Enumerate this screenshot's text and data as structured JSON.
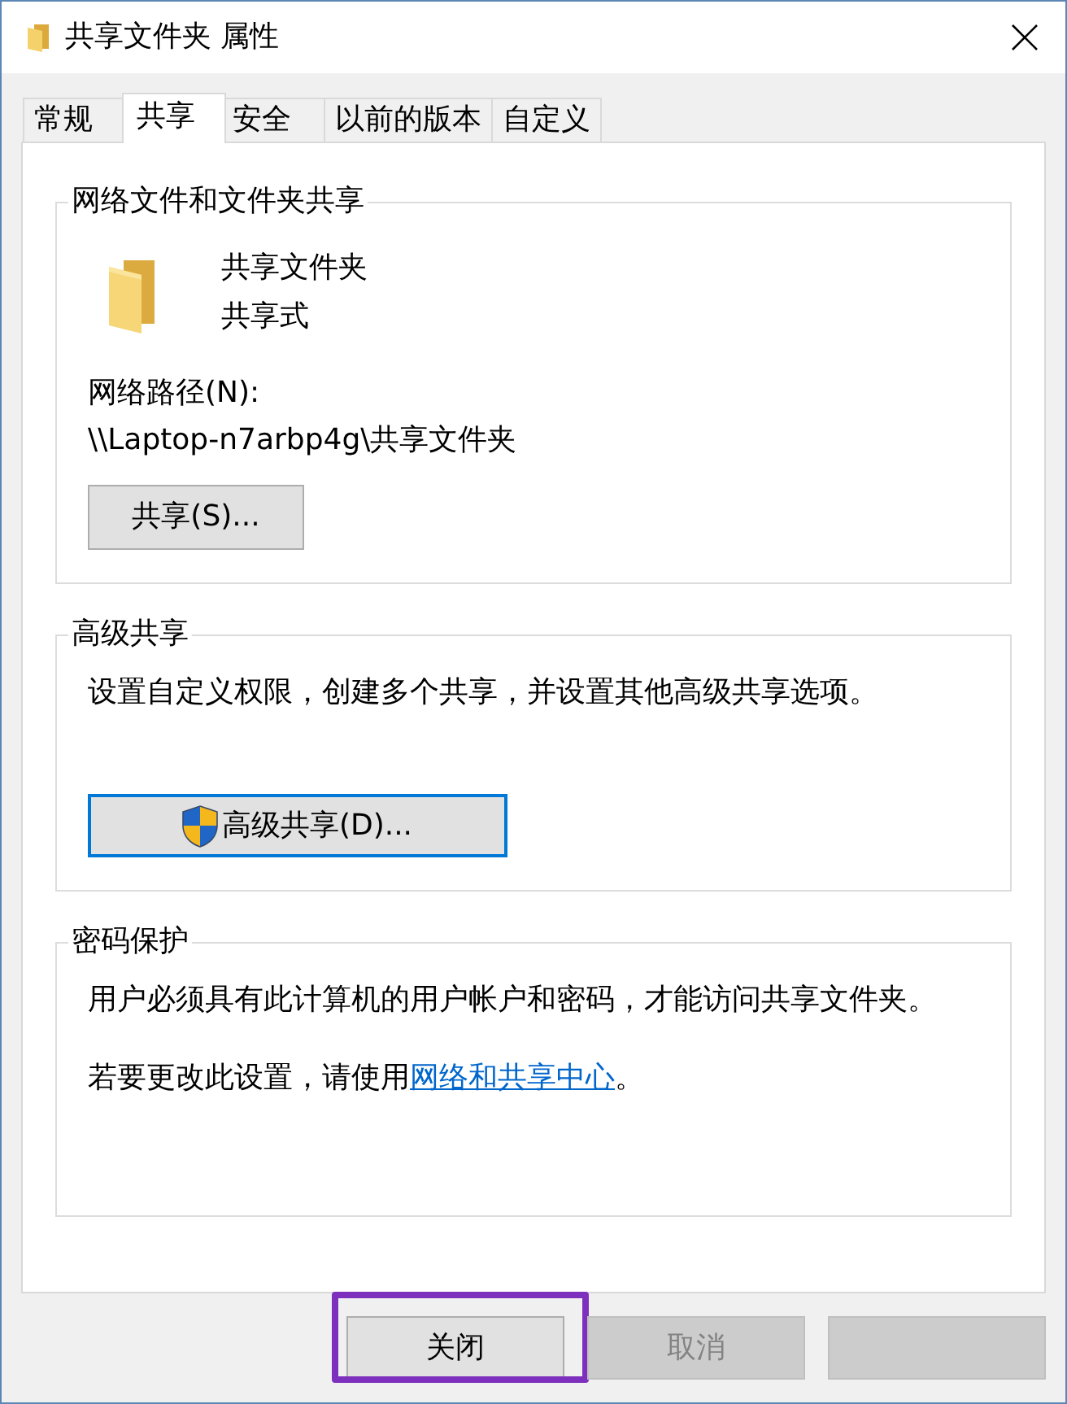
{
  "window": {
    "title": "共享文件夹 属性"
  },
  "tabs": [
    {
      "label": "常规",
      "selected": false
    },
    {
      "label": "共享",
      "selected": true
    },
    {
      "label": "安全",
      "selected": false
    },
    {
      "label": "以前的版本",
      "selected": false
    },
    {
      "label": "自定义",
      "selected": false
    }
  ],
  "groups": [
    {
      "title": "网络文件和文件夹共享",
      "items": [
        {
          "kind": "folder",
          "name": "共享文件夹",
          "status": "共享式"
        },
        {
          "kind": "label",
          "text": "网络路径(N):"
        },
        {
          "kind": "path",
          "text": "\\\\Laptop-n7arbp4g\\共享文件夹"
        },
        {
          "kind": "button",
          "label": "共享(S)...",
          "default": false,
          "shield": false
        }
      ]
    },
    {
      "title": "高级共享",
      "items": [
        {
          "kind": "text",
          "parts": [
            {
              "kind": "plain",
              "text": "设置自定义权限，创建多个共享，并设置其他高级共享选项。"
            }
          ]
        },
        {
          "kind": "button",
          "label": "高级共享(D)...",
          "default": true,
          "shield": true
        }
      ]
    },
    {
      "title": "密码保护",
      "items": [
        {
          "kind": "text",
          "parts": [
            {
              "kind": "plain",
              "text": "用户必须具有此计算机的用户帐户和密码，才能访问共享文件夹。"
            }
          ]
        },
        {
          "kind": "text",
          "parts": [
            {
              "kind": "plain",
              "text": "若要更改此设置，请使用"
            },
            {
              "kind": "link",
              "text": "网络和共享中心"
            },
            {
              "kind": "plain",
              "text": "。"
            }
          ]
        }
      ]
    }
  ],
  "footer_buttons": [
    {
      "label": "关闭",
      "disabled": false,
      "highlighted": true
    },
    {
      "label": "取消",
      "disabled": true,
      "highlighted": false
    },
    {
      "disabled": true,
      "highlighted": false
    }
  ]
}
